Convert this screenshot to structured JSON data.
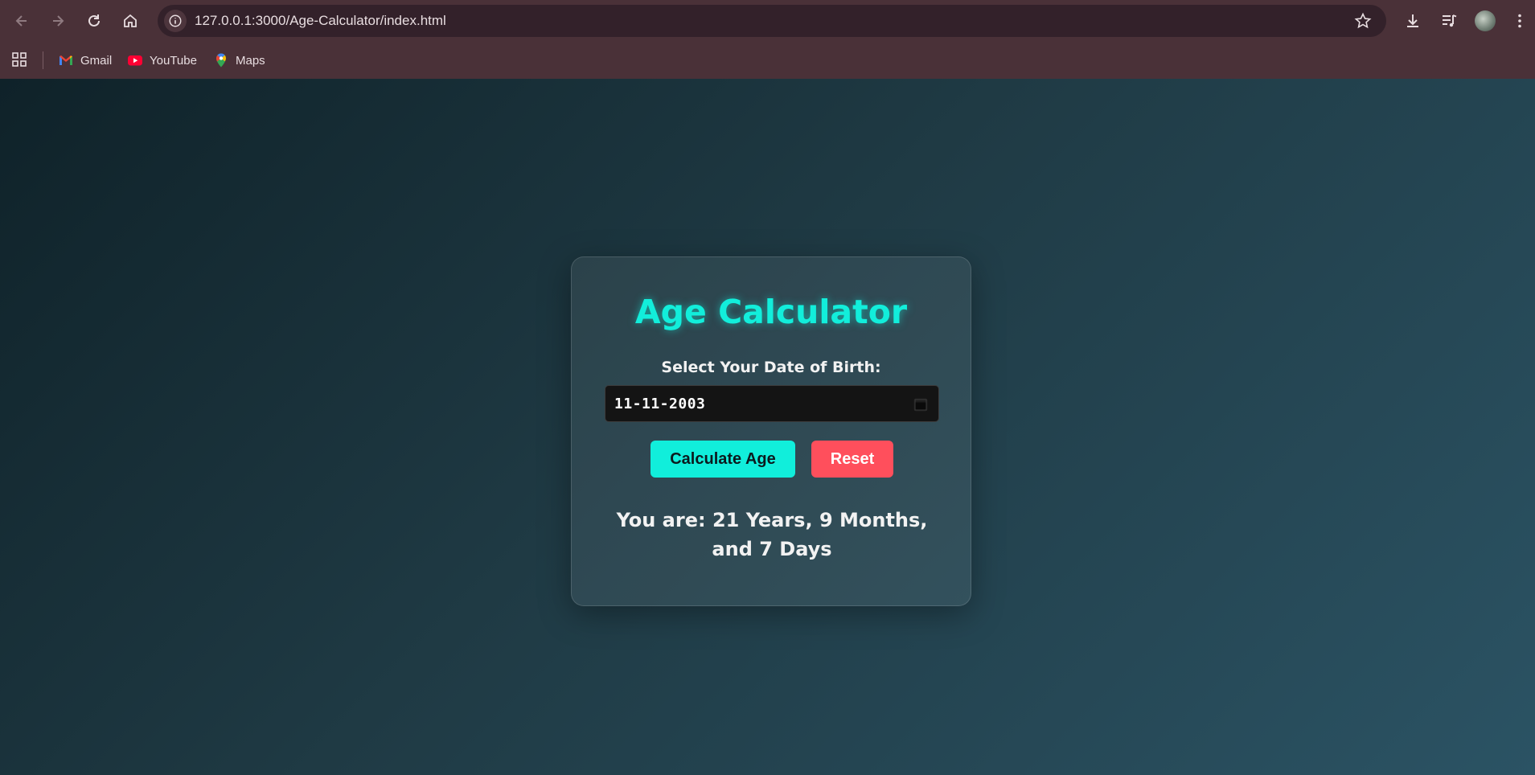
{
  "browser": {
    "url": "127.0.0.1:3000/Age-Calculator/index.html",
    "bookmarks": [
      {
        "label": "Gmail",
        "icon": "gmail-icon"
      },
      {
        "label": "YouTube",
        "icon": "youtube-icon"
      },
      {
        "label": "Maps",
        "icon": "maps-icon"
      }
    ]
  },
  "page": {
    "title": "Age Calculator",
    "dob_label": "Select Your Date of Birth:",
    "dob_value": "11-11-2003",
    "calculate_label": "Calculate Age",
    "reset_label": "Reset",
    "result": "You are: 21 Years, 9 Months, and 7 Days"
  },
  "colors": {
    "accent": "#12eedb",
    "reset": "#ff4f5c",
    "chrome": "#4a3138"
  }
}
